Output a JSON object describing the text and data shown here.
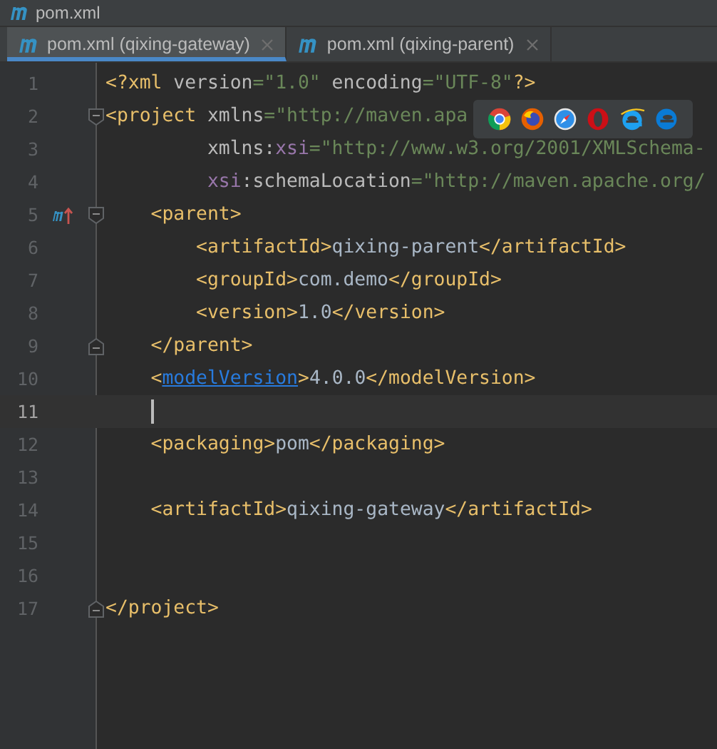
{
  "breadcrumb": {
    "file": "pom.xml"
  },
  "tabs": [
    {
      "label": "pom.xml (qixing-gateway)",
      "selected": true
    },
    {
      "label": "pom.xml (qixing-parent)",
      "selected": false
    }
  ],
  "lines": [
    {
      "number": "1",
      "current": false,
      "tokens": [
        {
          "kind": "tag",
          "text": "<?xml "
        },
        {
          "kind": "attr",
          "text": "version"
        },
        {
          "kind": "value",
          "text": "=\"1.0\" "
        },
        {
          "kind": "attr",
          "text": "encoding"
        },
        {
          "kind": "value",
          "text": "=\"UTF-8\""
        },
        {
          "kind": "tag",
          "text": "?>"
        }
      ]
    },
    {
      "number": "2",
      "current": false,
      "fold_start": true,
      "tokens": [
        {
          "kind": "tag",
          "text": "<project "
        },
        {
          "kind": "attr",
          "text": "xmlns"
        },
        {
          "kind": "value",
          "text": "=\"http://maven.apa"
        }
      ]
    },
    {
      "number": "3",
      "current": false,
      "tokens": [
        {
          "kind": "attr",
          "text": "         xmlns:"
        },
        {
          "kind": "ns",
          "text": "xsi"
        },
        {
          "kind": "value",
          "text": "=\"http://www.w3.org/2001/XMLSchema-"
        }
      ]
    },
    {
      "number": "4",
      "current": false,
      "tokens": [
        {
          "kind": "ns",
          "text": "         xsi"
        },
        {
          "kind": "attr",
          "text": ":schemaLocation"
        },
        {
          "kind": "value",
          "text": "=\"http://maven.apache.org/"
        }
      ]
    },
    {
      "number": "5",
      "current": false,
      "fold_start": true,
      "parent_marker": true,
      "tokens": [
        {
          "kind": "tag",
          "text": "    <parent>"
        }
      ]
    },
    {
      "number": "6",
      "current": false,
      "tokens": [
        {
          "kind": "tag",
          "text": "        <artifactId>"
        },
        {
          "kind": "text",
          "text": "qixing-parent"
        },
        {
          "kind": "tag",
          "text": "</artifactId>"
        }
      ]
    },
    {
      "number": "7",
      "current": false,
      "tokens": [
        {
          "kind": "tag",
          "text": "        <groupId>"
        },
        {
          "kind": "text",
          "text": "com.demo"
        },
        {
          "kind": "tag",
          "text": "</groupId>"
        }
      ]
    },
    {
      "number": "8",
      "current": false,
      "tokens": [
        {
          "kind": "tag",
          "text": "        <version>"
        },
        {
          "kind": "text",
          "text": "1.0"
        },
        {
          "kind": "tag",
          "text": "</version>"
        }
      ]
    },
    {
      "number": "9",
      "current": false,
      "fold_end": true,
      "tokens": [
        {
          "kind": "tag",
          "text": "    </parent>"
        }
      ]
    },
    {
      "number": "10",
      "current": false,
      "tokens": [
        {
          "kind": "tag",
          "text": "    <"
        },
        {
          "kind": "link",
          "text": "modelVersion"
        },
        {
          "kind": "tag",
          "text": ">"
        },
        {
          "kind": "text",
          "text": "4.0.0"
        },
        {
          "kind": "tag",
          "text": "</modelVersion>"
        }
      ]
    },
    {
      "number": "11",
      "current": true,
      "caret": true
    },
    {
      "number": "12",
      "current": false,
      "tokens": [
        {
          "kind": "tag",
          "text": "    <packaging>"
        },
        {
          "kind": "text",
          "text": "pom"
        },
        {
          "kind": "tag",
          "text": "</packaging>"
        }
      ]
    },
    {
      "number": "13",
      "current": false
    },
    {
      "number": "14",
      "current": false,
      "tokens": [
        {
          "kind": "tag",
          "text": "    <artifactId>"
        },
        {
          "kind": "text",
          "text": "qixing-gateway"
        },
        {
          "kind": "tag",
          "text": "</artifactId>"
        }
      ]
    },
    {
      "number": "15",
      "current": false
    },
    {
      "number": "16",
      "current": false
    },
    {
      "number": "17",
      "current": false,
      "fold_end": true,
      "tokens": [
        {
          "kind": "tag",
          "text": "</project>"
        }
      ]
    }
  ],
  "browser_popup": {
    "icons": [
      {
        "kind": "chrome"
      },
      {
        "kind": "firefox"
      },
      {
        "kind": "safari"
      },
      {
        "kind": "opera"
      },
      {
        "kind": "ie"
      },
      {
        "kind": "edge"
      }
    ]
  }
}
